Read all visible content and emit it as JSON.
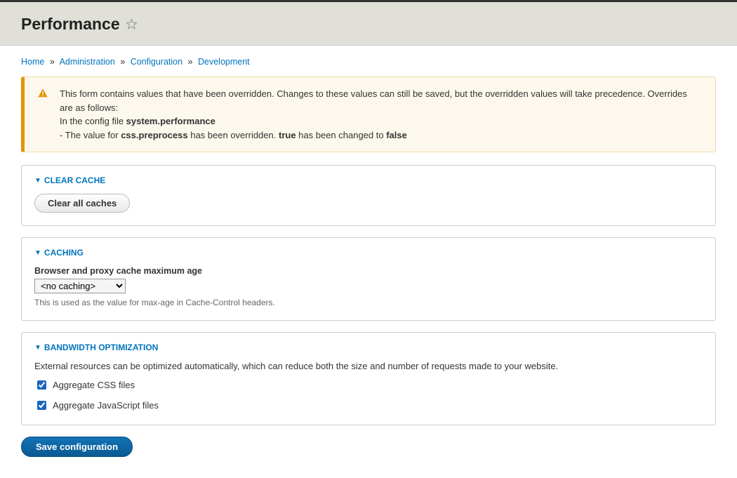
{
  "page": {
    "title": "Performance"
  },
  "breadcrumb": {
    "items": [
      "Home",
      "Administration",
      "Configuration",
      "Development"
    ],
    "sep": "»"
  },
  "warning": {
    "intro": "This form contains values that have been overridden. Changes to these values can still be saved, but the overridden values will take precedence. Overrides are as follows:",
    "line1_prefix": "In the config file ",
    "line1_strong": "system.performance",
    "line2_prefix": "- The value for ",
    "line2_key": "css.preprocess",
    "line2_mid1": " has been overridden. ",
    "line2_old": "true",
    "line2_mid2": " has been changed to ",
    "line2_new": "false"
  },
  "sections": {
    "clear_cache": {
      "legend": "CLEAR CACHE",
      "button": "Clear all caches"
    },
    "caching": {
      "legend": "CACHING",
      "label": "Browser and proxy cache maximum age",
      "selected": "<no caching>",
      "description": "This is used as the value for max-age in Cache-Control headers."
    },
    "bandwidth": {
      "legend": "BANDWIDTH OPTIMIZATION",
      "intro": "External resources can be optimized automatically, which can reduce both the size and number of requests made to your website.",
      "css_label": "Aggregate CSS files",
      "js_label": "Aggregate JavaScript files",
      "css_checked": true,
      "js_checked": true
    }
  },
  "actions": {
    "save": "Save configuration"
  }
}
